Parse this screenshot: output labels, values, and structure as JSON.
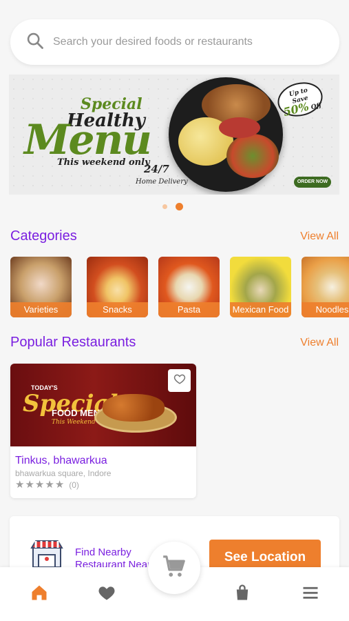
{
  "search": {
    "placeholder": "Search your desired foods or restaurants"
  },
  "banner": {
    "special": "Special",
    "healthy": "Healthy",
    "menu": "Menu",
    "weekend": "This weekend only",
    "delivery_hours": "24/7",
    "delivery_label": "Home Delivery",
    "save_prefix": "Up to",
    "save_word": "Save",
    "save_pct": "50%",
    "save_suffix": "Off",
    "order_now": "ORDER NOW"
  },
  "carousel": {
    "pages": 2,
    "active_index": 1
  },
  "categories": {
    "title": "Categories",
    "view_all": "View All",
    "items": [
      {
        "label": "Varieties",
        "color_a": "#c9a06b",
        "color_b": "#7a4a2a"
      },
      {
        "label": "Snacks",
        "color_a": "#d24e1f",
        "color_b": "#9b2d10"
      },
      {
        "label": "Pasta",
        "color_a": "#e0581e",
        "color_b": "#b6391a"
      },
      {
        "label": "Mexican Food",
        "color_a": "#f2dc3c",
        "color_b": "#8aa02c"
      },
      {
        "label": "Noodles",
        "color_a": "#eaa048",
        "color_b": "#c9742a"
      }
    ]
  },
  "popular": {
    "title": "Popular Restaurants",
    "view_all": "View All",
    "restaurants": [
      {
        "name": "Tinkus, bhawarkua",
        "address": "bhawarkua square, Indore",
        "rating": 0,
        "reviews": "(0)",
        "promo_todays": "TODAY'S",
        "promo_special": "Special",
        "promo_menu": "FOOD MENU",
        "promo_week": "This Weekend Only"
      }
    ]
  },
  "location": {
    "text": "Find Nearby Restaurant Near",
    "button": "See Location"
  },
  "colors": {
    "accent": "#ee7f2d",
    "brand": "#7a1fe0"
  },
  "nav": {
    "items": [
      "home-icon",
      "heart-icon",
      "cart-icon",
      "bag-icon",
      "menu-icon"
    ],
    "active": "home-icon"
  }
}
